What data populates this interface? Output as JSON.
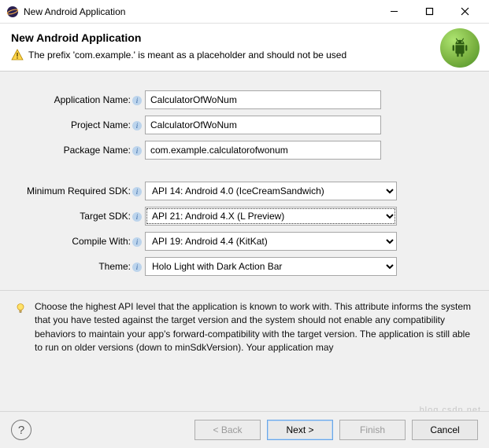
{
  "title": "New Android Application",
  "header": {
    "title": "New Android Application",
    "message": "The prefix 'com.example.' is meant as a placeholder and should not be used"
  },
  "form": {
    "appName": {
      "label": "Application Name:",
      "value": "CalculatorOfWoNum"
    },
    "projectName": {
      "label": "Project Name:",
      "value": "CalculatorOfWoNum"
    },
    "packageName": {
      "label": "Package Name:",
      "value": "com.example.calculatorofwonum"
    },
    "minSdk": {
      "label": "Minimum Required SDK:",
      "value": "API 14: Android 4.0 (IceCreamSandwich)"
    },
    "targetSdk": {
      "label": "Target SDK:",
      "value": "API 21: Android 4.X (L Preview)"
    },
    "compileWith": {
      "label": "Compile With:",
      "value": "API 19: Android 4.4 (KitKat)"
    },
    "theme": {
      "label": "Theme:",
      "value": "Holo Light with Dark Action Bar"
    }
  },
  "hint": "Choose the highest API level that the application is known to work with. This attribute informs the system that you have tested against the target version and the system should not enable any compatibility behaviors to maintain your app's forward-compatibility with the target version. The application is still able to run on older versions (down to minSdkVersion). Your application may",
  "buttons": {
    "back": "< Back",
    "next": "Next >",
    "finish": "Finish",
    "cancel": "Cancel"
  }
}
